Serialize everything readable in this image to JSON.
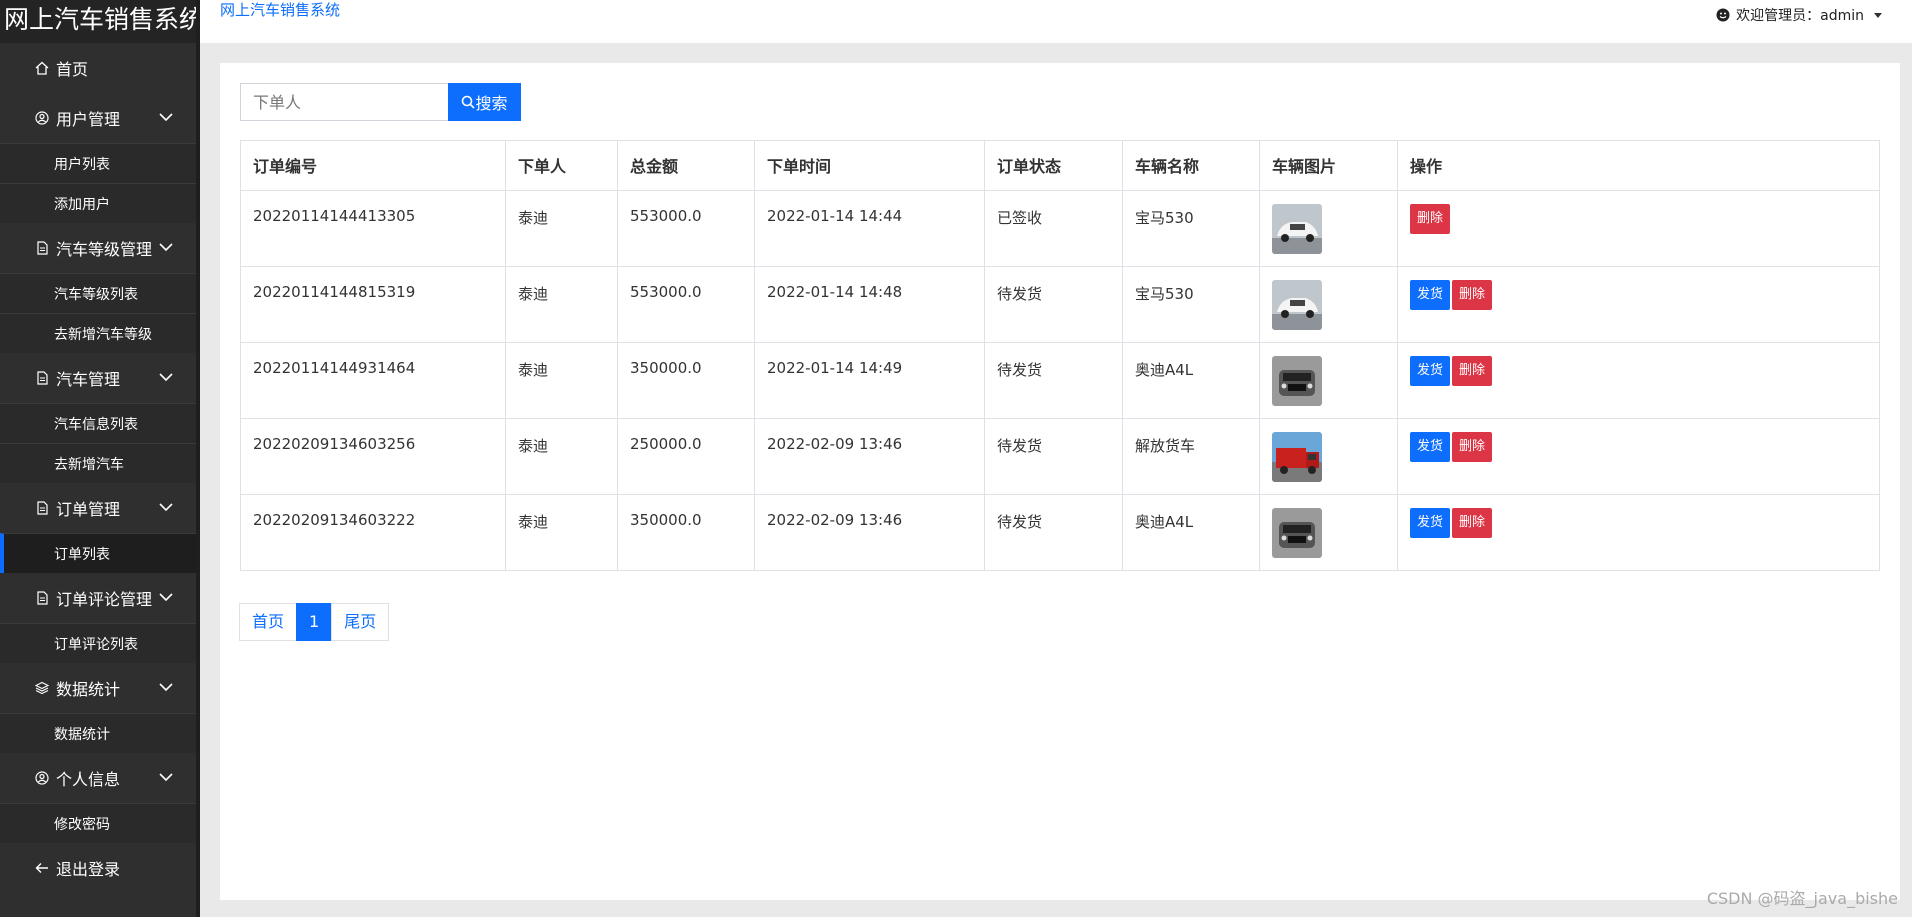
{
  "app": {
    "title": "网上汽车销售系统"
  },
  "header": {
    "breadcrumb": "网上汽车销售系统",
    "welcome": "欢迎管理员：admin"
  },
  "sidebar": {
    "home": "首页",
    "groups": [
      {
        "label": "用户管理",
        "items": [
          "用户列表",
          "添加用户"
        ]
      },
      {
        "label": "汽车等级管理",
        "items": [
          "汽车等级列表",
          "去新增汽车等级"
        ]
      },
      {
        "label": "汽车管理",
        "items": [
          "汽车信息列表",
          "去新增汽车"
        ]
      },
      {
        "label": "订单管理",
        "items": [
          "订单列表"
        ]
      },
      {
        "label": "订单评论管理",
        "items": [
          "订单评论列表"
        ]
      },
      {
        "label": "数据统计",
        "items": [
          "数据统计"
        ]
      },
      {
        "label": "个人信息",
        "items": [
          "修改密码"
        ]
      }
    ],
    "active_item": "订单列表",
    "logout": "退出登录"
  },
  "search": {
    "placeholder": "下单人",
    "button_label": "搜索"
  },
  "table": {
    "headers": [
      "订单编号",
      "下单人",
      "总金额",
      "下单时间",
      "订单状态",
      "车辆名称",
      "车辆图片",
      "操作"
    ],
    "rows": [
      {
        "id": "20220114144413305",
        "buyer": "泰迪",
        "amount": "553000.0",
        "time": "2022-01-14 14:44",
        "status": "已签收",
        "car": "宝马530",
        "img": "white-car",
        "actions": [
          "删除"
        ]
      },
      {
        "id": "20220114144815319",
        "buyer": "泰迪",
        "amount": "553000.0",
        "time": "2022-01-14 14:48",
        "status": "待发货",
        "car": "宝马530",
        "img": "white-car",
        "actions": [
          "发货",
          "删除"
        ]
      },
      {
        "id": "20220114144931464",
        "buyer": "泰迪",
        "amount": "350000.0",
        "time": "2022-01-14 14:49",
        "status": "待发货",
        "car": "奥迪A4L",
        "img": "grey-car",
        "actions": [
          "发货",
          "删除"
        ]
      },
      {
        "id": "20220209134603256",
        "buyer": "泰迪",
        "amount": "250000.0",
        "time": "2022-02-09 13:46",
        "status": "待发货",
        "car": "解放货车",
        "img": "red-truck",
        "actions": [
          "发货",
          "删除"
        ]
      },
      {
        "id": "20220209134603222",
        "buyer": "泰迪",
        "amount": "350000.0",
        "time": "2022-02-09 13:46",
        "status": "待发货",
        "car": "奥迪A4L",
        "img": "grey-car",
        "actions": [
          "发货",
          "删除"
        ]
      }
    ]
  },
  "pagination": {
    "first": "首页",
    "current": "1",
    "last": "尾页"
  },
  "watermark": "CSDN @码盗_java_bishe",
  "colors": {
    "primary": "#0d6efd",
    "danger": "#dc3545",
    "sidebar_bg": "#2f2f2f"
  }
}
